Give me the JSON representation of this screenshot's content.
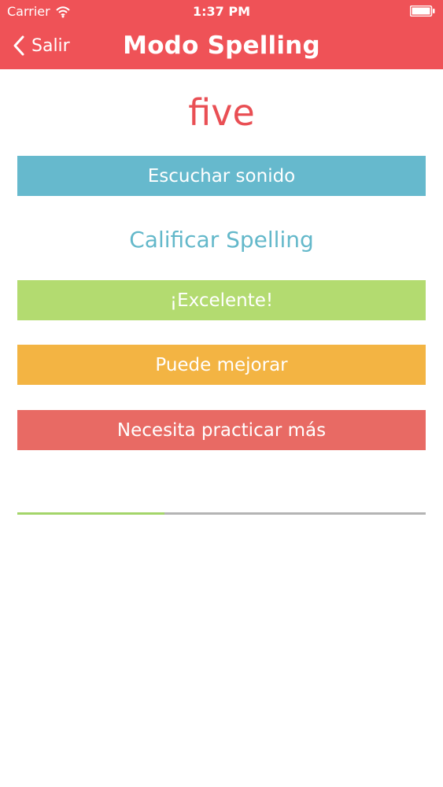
{
  "status_bar": {
    "carrier": "Carrier",
    "time": "1:37 PM",
    "wifi_icon": "wifi-icon",
    "battery_icon": "battery-icon"
  },
  "nav": {
    "back_label": "Salir",
    "back_icon": "chevron-left-icon",
    "title": "Modo Spelling"
  },
  "word": "five",
  "buttons": {
    "listen": "Escuchar sonido",
    "excellent": "¡Excelente!",
    "can_improve": "Puede mejorar",
    "needs_practice": "Necesita practicar más"
  },
  "section_title": "Calificar Spelling",
  "progress": {
    "fraction": 0.36
  },
  "colors": {
    "header": "#ef5257",
    "word": "#e94f54",
    "listen": "#66b9cd",
    "section_title": "#63b8ca",
    "excellent": "#b3db70",
    "can_improve": "#f3b443",
    "needs_practice": "#e86a64",
    "progress_fill": "#a3d56a",
    "progress_track": "#b4b4b4"
  }
}
